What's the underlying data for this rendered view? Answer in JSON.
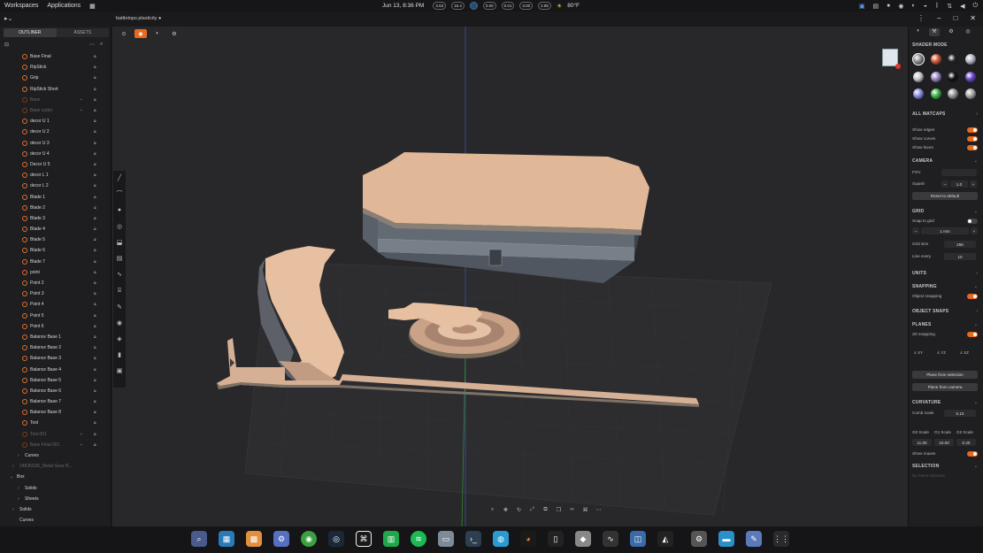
{
  "topbar": {
    "workspaces": "Workspaces",
    "applications": "Applications",
    "clock": "Jun 13, 8:36 PM",
    "indicators": [
      "3.53",
      "15.4",
      "",
      "0.00",
      "0.01",
      "3.00",
      "2.85"
    ],
    "weather": "80°F"
  },
  "titlebar": {
    "document": "battletops.plasticity ●"
  },
  "left": {
    "tabs": [
      "OUTLINER",
      "ASSETS"
    ],
    "items": [
      {
        "label": "Base Final",
        "dim": false
      },
      {
        "label": "RipStick",
        "dim": false
      },
      {
        "label": "Grip",
        "dim": false
      },
      {
        "label": "RipStick Short",
        "dim": false
      },
      {
        "label": "Base",
        "dim": true
      },
      {
        "label": "Base cutter",
        "dim": true
      },
      {
        "label": "decor U 1",
        "dim": false
      },
      {
        "label": "decor U 2",
        "dim": false
      },
      {
        "label": "decor U 3",
        "dim": false
      },
      {
        "label": "decor U 4",
        "dim": false
      },
      {
        "label": "Decor U 5",
        "dim": false
      },
      {
        "label": "decor L 1",
        "dim": false
      },
      {
        "label": "decor L 2",
        "dim": false
      },
      {
        "label": "Blade 1",
        "dim": false
      },
      {
        "label": "Blade 2",
        "dim": false
      },
      {
        "label": "Blade 3",
        "dim": false
      },
      {
        "label": "Blade 4",
        "dim": false
      },
      {
        "label": "Blade 5",
        "dim": false
      },
      {
        "label": "Blade 6",
        "dim": false
      },
      {
        "label": "Blade 7",
        "dim": false
      },
      {
        "label": "point",
        "dim": false
      },
      {
        "label": "Point 2",
        "dim": false
      },
      {
        "label": "Point 3",
        "dim": false
      },
      {
        "label": "Point 4",
        "dim": false
      },
      {
        "label": "Point 5",
        "dim": false
      },
      {
        "label": "Point 6",
        "dim": false
      },
      {
        "label": "Balance Base 1",
        "dim": false
      },
      {
        "label": "Balance Base 2",
        "dim": false
      },
      {
        "label": "Balance Base 3",
        "dim": false
      },
      {
        "label": "Balance Base 4",
        "dim": false
      },
      {
        "label": "Balance Base 5",
        "dim": false
      },
      {
        "label": "Balance Base 6",
        "dim": false
      },
      {
        "label": "Balance Base 7",
        "dim": false
      },
      {
        "label": "Balance Base 8",
        "dim": false
      },
      {
        "label": "Tool",
        "dim": false
      },
      {
        "label": "Tool.001",
        "dim": true
      },
      {
        "label": "Base Final.001",
        "dim": true
      }
    ],
    "groups": [
      "Curves",
      "2483N236_Metal Gear R...",
      "Box",
      "Solids",
      "Sheets",
      "Solids",
      "Curves"
    ]
  },
  "right": {
    "shader_mode": "SHADER MODE",
    "all_matcaps": "ALL MATCAPS",
    "show_edges": "Show edges",
    "show_curves": "Show curves",
    "show_faces": "Show faces",
    "camera": "CAMERA",
    "fov": "FOV",
    "squish": "Squish",
    "squish_value": "1.0",
    "reset_default": "Reset to default",
    "grid": "GRID",
    "snap_to_grid": "Snap to grid",
    "grid_step": "1 mm",
    "grid_size": "Grid size",
    "grid_size_value": "256",
    "line_every": "Line every",
    "line_every_value": "10",
    "units": "UNITS",
    "snapping": "SNAPPING",
    "object_snapping": "Object snapping",
    "object_snaps": "OBJECT SNAPS",
    "planes": "PLANES",
    "snapping_2d": "2D snapping",
    "plane_xy": "XY",
    "plane_yz": "YZ",
    "plane_xz": "XZ",
    "plane_from_selection": "Plane from selection",
    "plane_from_camera": "Plane from camera",
    "curvature": "CURVATURE",
    "comb_scale": "Comb scale",
    "comb_scale_value": "0.10",
    "g0": "G0 Scale",
    "g1": "G1 Scale",
    "g2": "G2 Scale",
    "g0v": "11.00",
    "g1v": "10.00",
    "g2v": "0.20",
    "show_maxes": "Show maxes",
    "selection": "SELECTION",
    "selection_hint": "No items selected"
  }
}
